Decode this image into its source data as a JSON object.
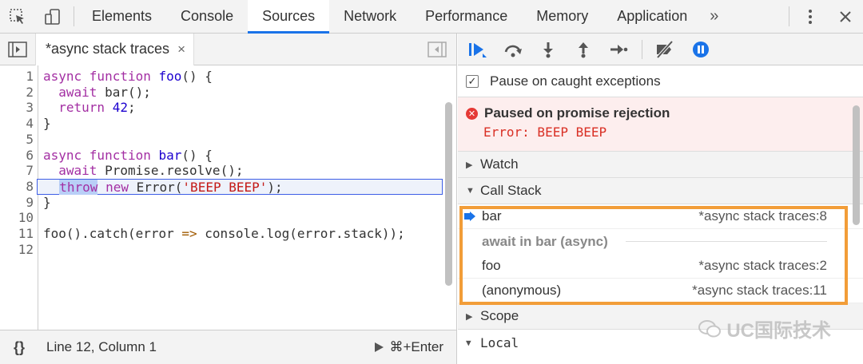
{
  "devtools": {
    "tabs": [
      {
        "label": "Elements"
      },
      {
        "label": "Console"
      },
      {
        "label": "Sources"
      },
      {
        "label": "Network"
      },
      {
        "label": "Performance"
      },
      {
        "label": "Memory"
      },
      {
        "label": "Application"
      }
    ],
    "more_tabs": "»",
    "active_tab": "Sources"
  },
  "sources": {
    "file_tab": {
      "label": "*async stack traces",
      "close": "×"
    },
    "code_lines": [
      {
        "n": "1"
      },
      {
        "n": "2"
      },
      {
        "n": "3"
      },
      {
        "n": "4"
      },
      {
        "n": "5"
      },
      {
        "n": "6"
      },
      {
        "n": "7"
      },
      {
        "n": "8"
      },
      {
        "n": "9"
      },
      {
        "n": "10"
      },
      {
        "n": "11"
      },
      {
        "n": "12"
      }
    ],
    "status": {
      "braces": "{}",
      "position": "Line 12, Column 1",
      "run": "⌘+Enter"
    }
  },
  "debugger": {
    "pause_caught_label": "Pause on caught exceptions",
    "pause_caught_checked": true,
    "paused": {
      "title": "Paused on promise rejection",
      "message": "Error: BEEP BEEP"
    },
    "watch_label": "Watch",
    "call_stack_label": "Call Stack",
    "call_stack": [
      {
        "fn": "bar",
        "loc": "*async stack traces:8"
      },
      {
        "fn": "foo",
        "loc": "*async stack traces:2"
      },
      {
        "fn": "(anonymous)",
        "loc": "*async stack traces:11"
      }
    ],
    "async_separator": "await in bar (async)",
    "scope_label": "Scope",
    "local_label": "Local"
  },
  "watermark": "UC国际技术",
  "colors": {
    "accent": "#1a73e8",
    "highlight_box": "#f29d38",
    "error_bg": "#fdeeee",
    "error_text": "#d93025"
  }
}
